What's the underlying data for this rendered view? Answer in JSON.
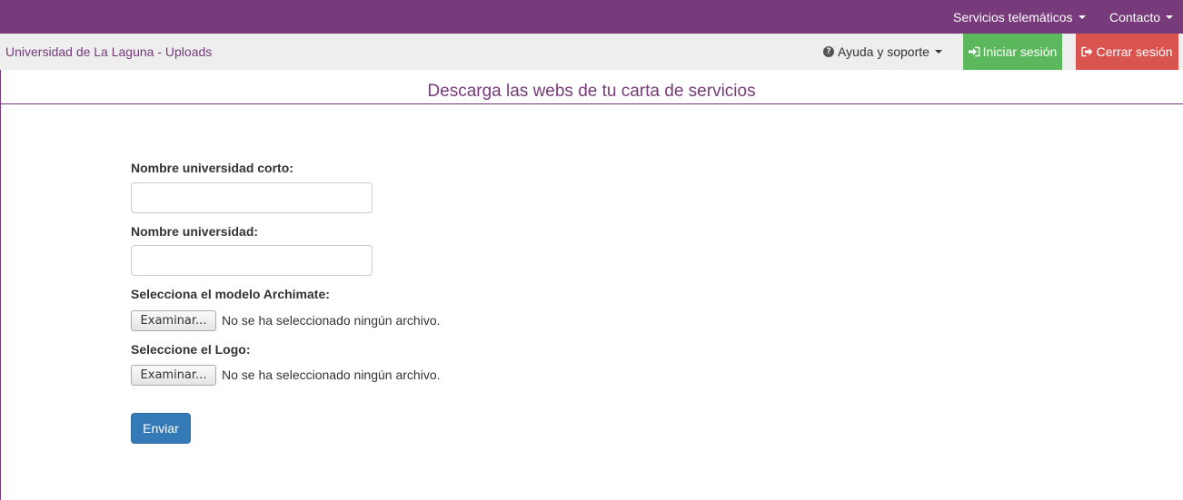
{
  "topbar": {
    "background": "#773a7a",
    "menus": [
      {
        "label": "Servicios telemáticos"
      },
      {
        "label": "Contacto"
      }
    ]
  },
  "navbar": {
    "brand": "Universidad de La Laguna - Uploads",
    "help_label": "Ayuda y soporte",
    "login_label": "Iniciar sesión",
    "logout_label": "Cerrar sesión",
    "colors": {
      "brand": "#773a7a",
      "login": "#5cb85c",
      "logout": "#d9534f"
    }
  },
  "page": {
    "title": "Descarga las webs de tu carta de servicios"
  },
  "form": {
    "short_name_label": "Nombre universidad corto:",
    "short_name_value": "",
    "full_name_label": "Nombre universidad:",
    "full_name_value": "",
    "archimate_label": "Selecciona el modelo Archimate:",
    "logo_label": "Seleccione el Logo:",
    "browse_label": "Examinar...",
    "no_file_text": "No se ha seleccionado ningún archivo.",
    "submit_label": "Enviar",
    "submit_color": "#337ab7"
  }
}
